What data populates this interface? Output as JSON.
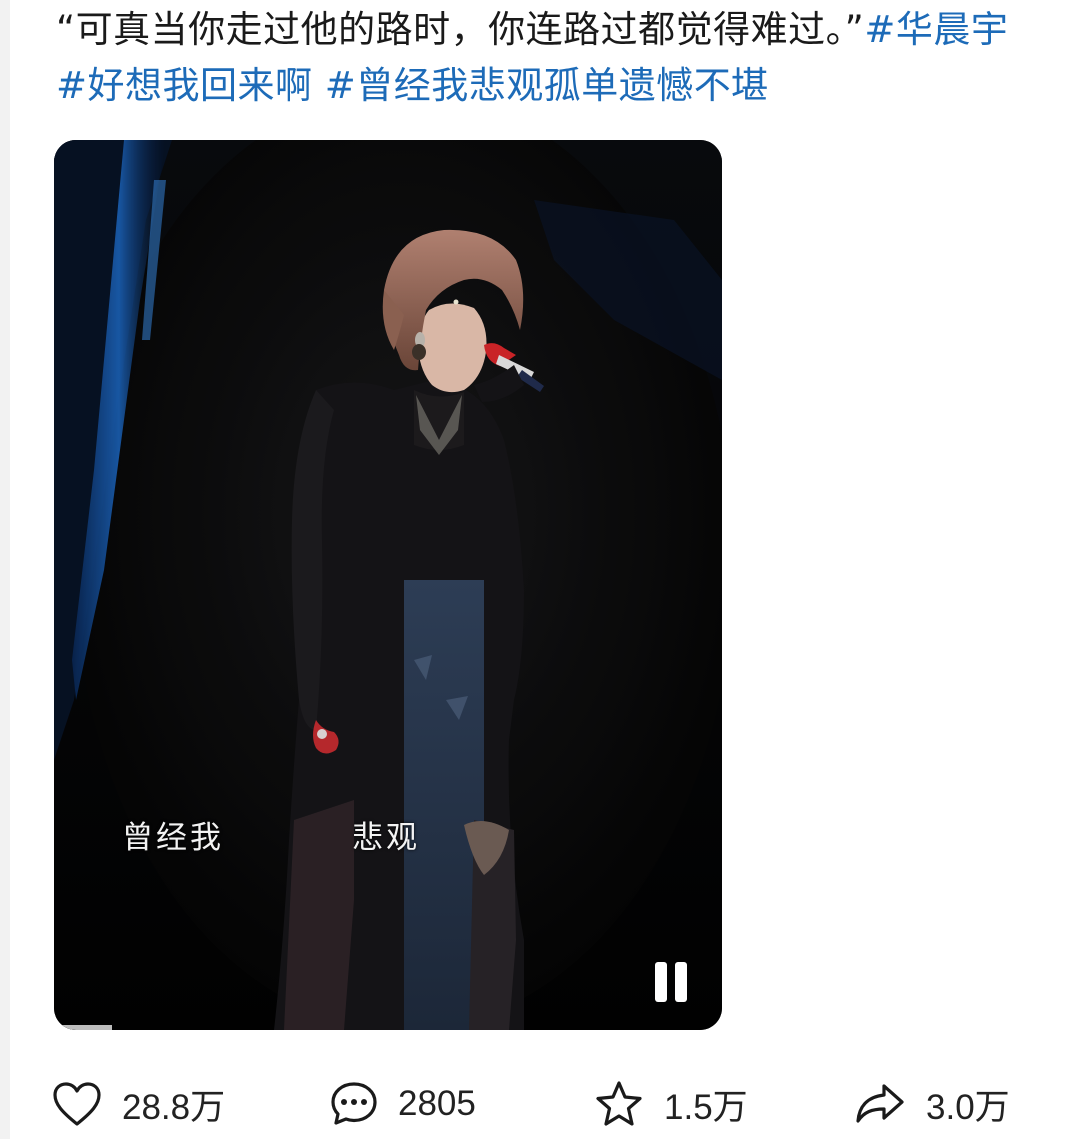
{
  "post": {
    "quote": "“可真当你走过他的路时，你连路过都觉得难过。”",
    "hashtags": [
      "#华晨宇",
      "#好想我回来啊",
      "#曾经我悲观孤单遗憾不堪"
    ]
  },
  "video": {
    "subtitle_left": "曾经我",
    "subtitle_right": "悲观",
    "state": "playing"
  },
  "actions": {
    "likes": "28.8万",
    "comments": "2805",
    "favorites": "1.5万",
    "shares": "3.0万"
  },
  "colors": {
    "hashtag": "#1d6bb8",
    "text": "#1a1a1a",
    "stage_light": "#1f6fd0"
  }
}
